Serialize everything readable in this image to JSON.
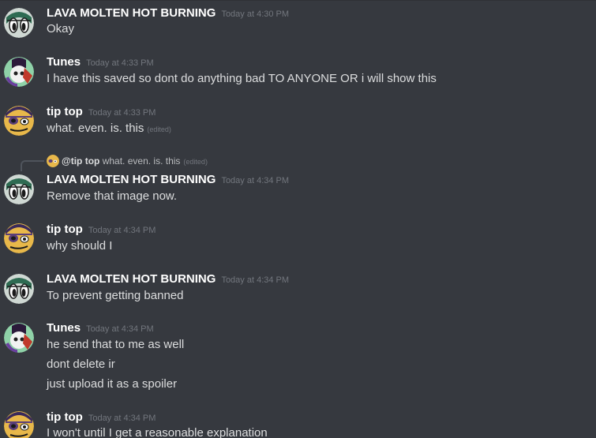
{
  "messages": [
    {
      "username": "LAVA MOLTEN HOT BURNING",
      "timestamp": "Today at 4:30 PM",
      "avatar": "lava-avatar",
      "lines": [
        "Okay"
      ]
    },
    {
      "username": "Tunes",
      "timestamp": "Today at 4:33 PM",
      "avatar": "tunes-avatar",
      "lines": [
        "I have this  saved so dont do anything bad TO ANYONE  OR i will show this"
      ]
    },
    {
      "username": "tip top",
      "timestamp": "Today at 4:33 PM",
      "avatar": "tiptop-avatar",
      "lines": [
        "what. even. is. this"
      ],
      "edited": "(edited)"
    },
    {
      "reply": {
        "mention": "@tip top",
        "text": "what. even. is. this",
        "edited": "(edited)",
        "avatar": "tiptop-avatar"
      },
      "username": "LAVA MOLTEN HOT BURNING",
      "timestamp": "Today at 4:34 PM",
      "avatar": "lava-avatar",
      "lines": [
        "Remove that image now."
      ]
    },
    {
      "username": "tip top",
      "timestamp": "Today at 4:34 PM",
      "avatar": "tiptop-avatar",
      "lines": [
        "why should I"
      ]
    },
    {
      "username": "LAVA MOLTEN HOT BURNING",
      "timestamp": "Today at 4:34 PM",
      "avatar": "lava-avatar",
      "lines": [
        "To prevent getting banned"
      ]
    },
    {
      "username": "Tunes",
      "timestamp": "Today at 4:34 PM",
      "avatar": "tunes-avatar",
      "lines": [
        "he send that to me as well",
        "dont delete ir",
        "just upload it as a spoiler"
      ]
    },
    {
      "username": "tip top",
      "timestamp": "Today at 4:34 PM",
      "avatar": "tiptop-avatar",
      "lines": [
        "I won't until I get a reasonable explanation"
      ]
    }
  ]
}
